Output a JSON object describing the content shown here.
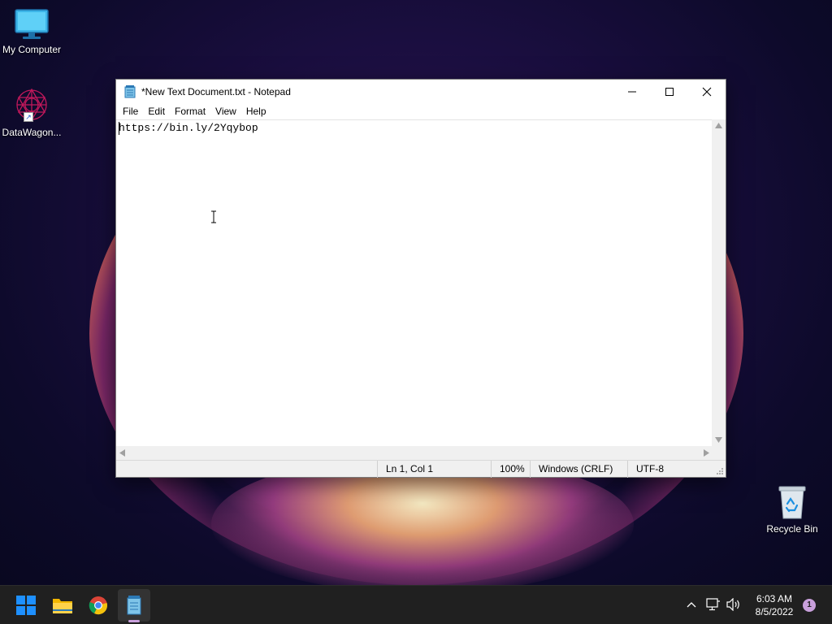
{
  "desktop": {
    "icons": [
      {
        "label": "My Computer"
      },
      {
        "label": "DataWagon..."
      },
      {
        "label": "Recycle Bin"
      }
    ]
  },
  "notepad": {
    "title": "*New Text Document.txt - Notepad",
    "menu": [
      "File",
      "Edit",
      "Format",
      "View",
      "Help"
    ],
    "content": "https://bin.ly/2Yqybop",
    "status": {
      "position": "Ln 1, Col 1",
      "zoom": "100%",
      "line_ending": "Windows (CRLF)",
      "encoding": "UTF-8"
    }
  },
  "taskbar": {
    "time": "6:03 AM",
    "date": "8/5/2022",
    "notification_count": "1"
  },
  "colors": {
    "taskbar_bg": "#202020",
    "start_blue": "#1e90ff",
    "notif_badge": "#c9a0dc"
  }
}
